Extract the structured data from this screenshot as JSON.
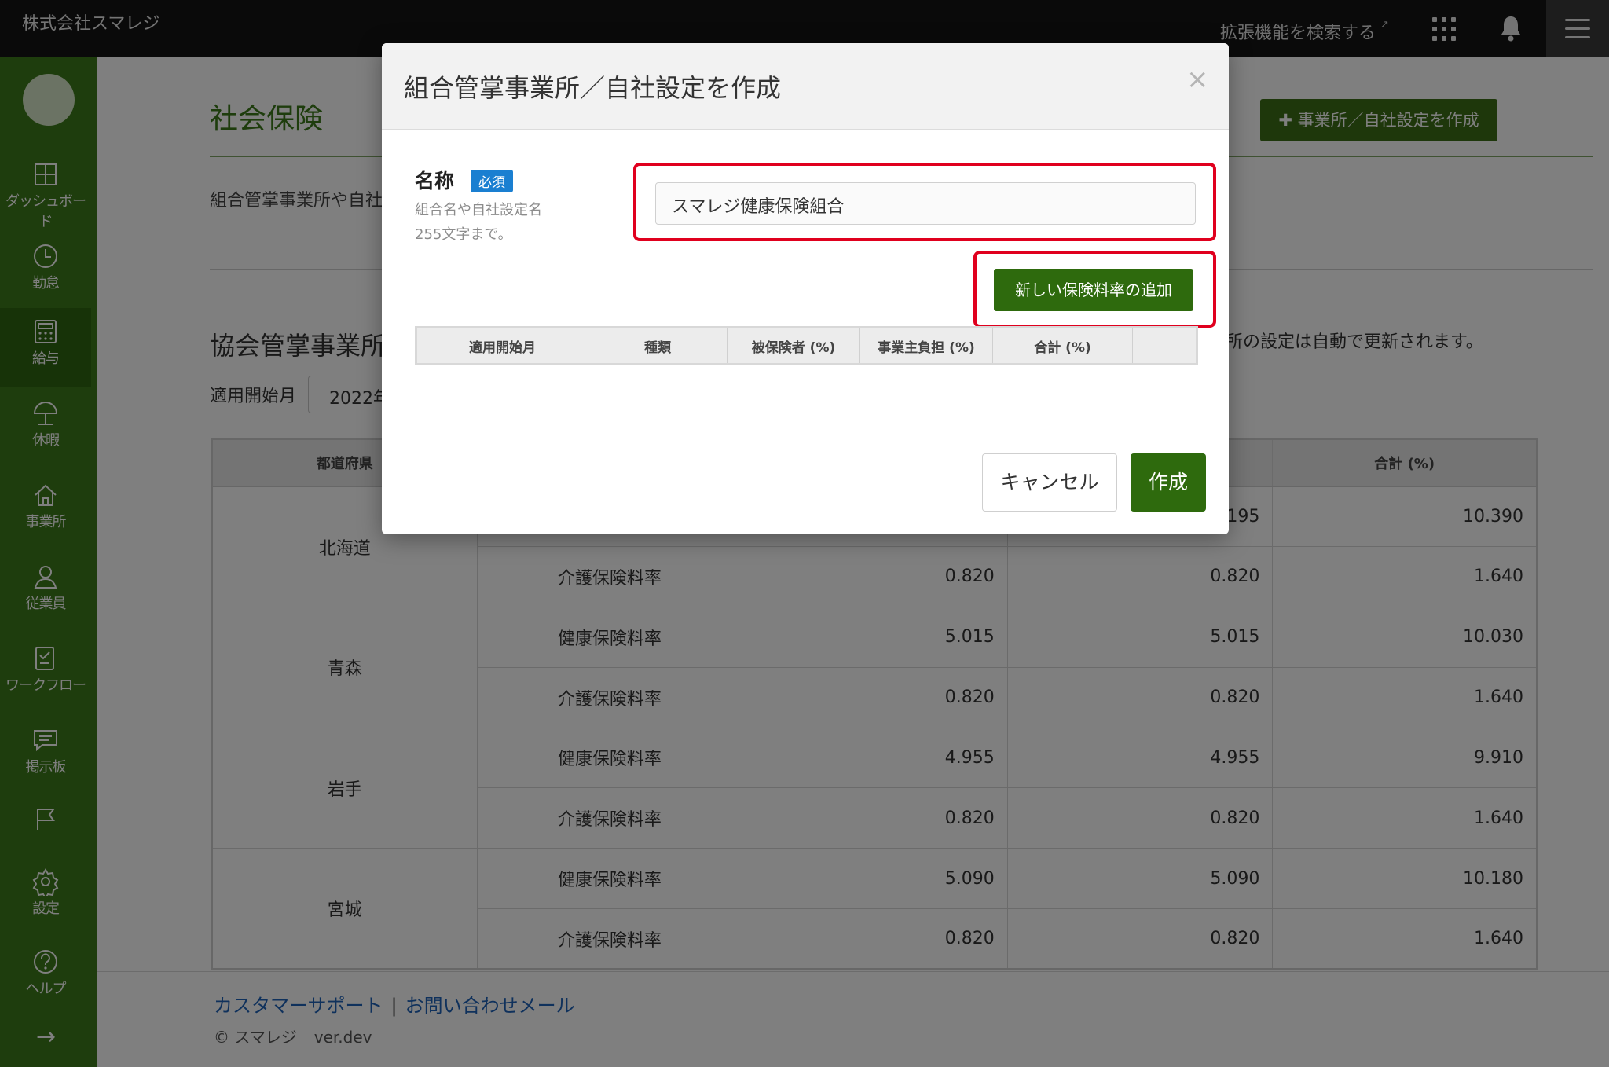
{
  "topbar": {
    "company": "株式会社スマレジ",
    "extension_search": "拡張機能を検索する",
    "ext_icon": "external-link-icon",
    "grid_icon": "apps-grid-icon",
    "bell_icon": "bell-icon",
    "menu_icon": "hamburger-menu-icon"
  },
  "sidebar": {
    "items": [
      {
        "label": "ダッシュボード",
        "icon": "dashboard-icon"
      },
      {
        "label": "勤怠",
        "icon": "clock-icon"
      },
      {
        "label": "給与",
        "icon": "calculator-icon"
      },
      {
        "label": "休暇",
        "icon": "beach-umbrella-icon"
      },
      {
        "label": "事業所",
        "icon": "home-icon"
      },
      {
        "label": "従業員",
        "icon": "person-icon"
      },
      {
        "label": "ワークフロー",
        "icon": "checklist-icon"
      },
      {
        "label": "掲示板",
        "icon": "message-board-icon"
      },
      {
        "label": "",
        "icon": "flag-icon"
      },
      {
        "label": "設定",
        "icon": "gear-icon"
      },
      {
        "label": "ヘルプ",
        "icon": "help-icon"
      }
    ],
    "expand_icon": "→"
  },
  "main": {
    "title": "社会保険",
    "add_office_button": "事業所／自社設定を作成",
    "add_office_icon": "✚",
    "description": "組合管掌事業所や自社",
    "section_title": "協会管掌事業所",
    "section_note": "所の設定は自動で更新されます。",
    "month_label": "適用開始月",
    "month_value": "2022年",
    "table": {
      "headers": [
        "都道府県",
        "",
        "",
        "",
        "合計 (%)"
      ],
      "rows": [
        {
          "pref": "北海道",
          "kind": "",
          "ins": "",
          "emp": "195",
          "total": "10.390"
        },
        {
          "pref": "",
          "kind": "介護保険料率",
          "ins": "0.820",
          "emp": "0.820",
          "total": "1.640"
        },
        {
          "pref": "青森",
          "kind": "健康保険料率",
          "ins": "5.015",
          "emp": "5.015",
          "total": "10.030"
        },
        {
          "pref": "",
          "kind": "介護保険料率",
          "ins": "0.820",
          "emp": "0.820",
          "total": "1.640"
        },
        {
          "pref": "岩手",
          "kind": "健康保険料率",
          "ins": "4.955",
          "emp": "4.955",
          "total": "9.910"
        },
        {
          "pref": "",
          "kind": "介護保険料率",
          "ins": "0.820",
          "emp": "0.820",
          "total": "1.640"
        },
        {
          "pref": "宮城",
          "kind": "健康保険料率",
          "ins": "5.090",
          "emp": "5.090",
          "total": "10.180"
        },
        {
          "pref": "",
          "kind": "介護保険料率",
          "ins": "0.820",
          "emp": "0.820",
          "total": "1.640"
        }
      ]
    }
  },
  "footer": {
    "support_link": "カスタマーサポート",
    "separator": "|",
    "contact_link": "お問い合わせメール",
    "copyright": "© スマレジ",
    "version": "ver.dev"
  },
  "modal": {
    "title": "組合管掌事業所／自社設定を作成",
    "close": "×",
    "name_label": "名称",
    "required_badge": "必須",
    "help_line1": "組合名や自社設定名",
    "help_line2": "255文字まで。",
    "name_value": "スマレジ健康保険組合",
    "add_rate_button": "新しい保険料率の追加",
    "rate_table_headers": [
      "適用開始月",
      "種類",
      "被保険者 (%)",
      "事業主負担 (%)",
      "合計 (%)",
      ""
    ],
    "cancel_button": "キャンセル",
    "create_button": "作成"
  },
  "colors": {
    "brand_green": "#3c7a1a",
    "button_green": "#2e6a0d",
    "highlight_red": "#e0001e",
    "required_blue": "#1a7fd1",
    "link_blue": "#1f62b8"
  }
}
